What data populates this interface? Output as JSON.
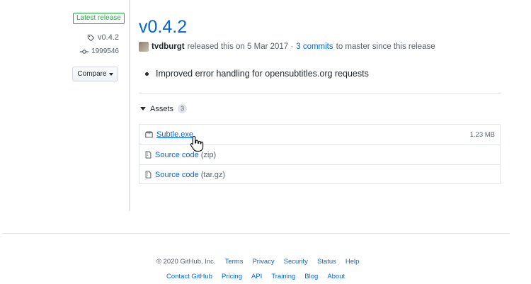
{
  "sidebar": {
    "latest_badge": "Latest release",
    "tag": "v0.4.2",
    "commit": "1999546",
    "compare_label": "Compare"
  },
  "release": {
    "title": "v0.4.2",
    "author": "tvdburgt",
    "released_text": "released this on 5 Mar 2017 ·",
    "commits_link": "3 commits",
    "commits_suffix": "to master since this release",
    "notes": [
      "Improved error handling for opensubtitles.org requests"
    ]
  },
  "assets": {
    "header": "Assets",
    "count": "3",
    "items": [
      {
        "name": "Subtle.exe",
        "sub": "",
        "size": "1.23 MB",
        "icon": "package-icon"
      },
      {
        "name": "Source code",
        "sub": "(zip)",
        "size": "",
        "icon": "file-zip-icon"
      },
      {
        "name": "Source code",
        "sub": "(tar.gz)",
        "size": "",
        "icon": "file-zip-icon"
      }
    ]
  },
  "footer": {
    "copyright": "© 2020 GitHub, Inc.",
    "row1": [
      "Terms",
      "Privacy",
      "Security",
      "Status",
      "Help"
    ],
    "row2": [
      "Contact GitHub",
      "Pricing",
      "API",
      "Training",
      "Blog",
      "About"
    ]
  },
  "colors": {
    "link": "#0366d6",
    "badge_green": "#28a745",
    "muted": "#586069"
  }
}
